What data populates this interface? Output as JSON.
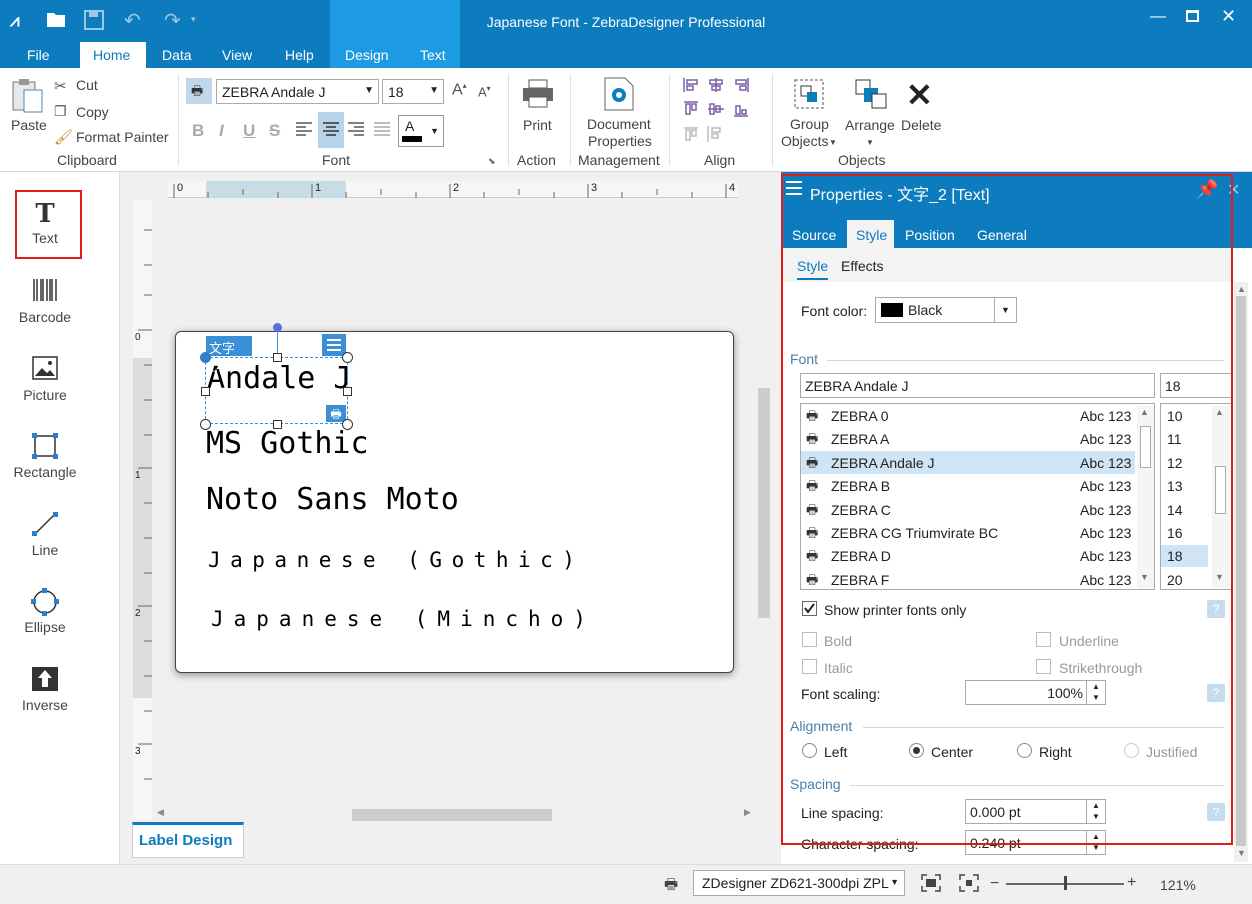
{
  "window": {
    "title": "Japanese Font - ZebraDesigner Professional"
  },
  "menu_tabs": [
    "File",
    "Home",
    "Data",
    "View",
    "Help",
    "Design",
    "Text"
  ],
  "ribbon": {
    "clipboard": {
      "paste": "Paste",
      "cut": "Cut",
      "copy": "Copy",
      "format_painter": "Format Painter",
      "group": "Clipboard"
    },
    "font": {
      "family": "ZEBRA Andale J",
      "size": "18",
      "group": "Font",
      "color_letter": "A"
    },
    "action": {
      "print": "Print",
      "group": "Action"
    },
    "management": {
      "line1": "Document",
      "line2": "Properties",
      "group": "Management"
    },
    "align": {
      "group": "Align"
    },
    "objects": {
      "group_line1": "Group",
      "group_line2": "Objects",
      "arrange": "Arrange",
      "delete": "Delete",
      "group": "Objects"
    }
  },
  "toolbox": [
    "Text",
    "Barcode",
    "Picture",
    "Rectangle",
    "Line",
    "Ellipse",
    "Inverse"
  ],
  "rulers": {
    "h": [
      "0",
      "1",
      "2",
      "3",
      "4"
    ],
    "v": [
      "0",
      "1",
      "2",
      "3"
    ]
  },
  "label": {
    "selected_name": "文字_2",
    "lines": [
      "Andale J",
      "MS Gothic",
      "Noto Sans Moto",
      "Japanese (Gothic)",
      "Japanese (Mincho)"
    ]
  },
  "bottom_tab": "Label Design",
  "properties": {
    "title": "Properties - 文字_2 [Text]",
    "tabs": [
      "Source",
      "Style",
      "Position",
      "General"
    ],
    "subtabs": [
      "Style",
      "Effects"
    ],
    "font_color_label": "Font color:",
    "font_color_value": "Black",
    "font_section": "Font",
    "font_name": "ZEBRA Andale J",
    "font_size": "18",
    "font_list": [
      {
        "name": "ZEBRA 0",
        "sample": "Abc 123"
      },
      {
        "name": "ZEBRA A",
        "sample": "Abc 123"
      },
      {
        "name": "ZEBRA Andale J",
        "sample": "Abc 123"
      },
      {
        "name": "ZEBRA B",
        "sample": "Abc 123"
      },
      {
        "name": "ZEBRA C",
        "sample": "Abc 123"
      },
      {
        "name": "ZEBRA CG Triumvirate BC",
        "sample": "Abc 123"
      },
      {
        "name": "ZEBRA D",
        "sample": "Abc 123"
      },
      {
        "name": "ZEBRA F",
        "sample": "Abc 123"
      }
    ],
    "size_list": [
      "10",
      "11",
      "12",
      "13",
      "14",
      "16",
      "18",
      "20"
    ],
    "show_printer_fonts": "Show printer fonts only",
    "bold": "Bold",
    "italic": "Italic",
    "underline": "Underline",
    "strikethrough": "Strikethrough",
    "font_scaling_label": "Font scaling:",
    "font_scaling_value": "100%",
    "alignment_section": "Alignment",
    "align_left": "Left",
    "align_center": "Center",
    "align_right": "Right",
    "align_justified": "Justified",
    "spacing_section": "Spacing",
    "line_spacing_label": "Line spacing:",
    "line_spacing_value": "0.000 pt",
    "char_spacing_label": "Character spacing:",
    "char_spacing_value": "0.240 pt"
  },
  "status": {
    "printer": "ZDesigner ZD621-300dpi ZPL",
    "zoom": "121%"
  },
  "colors": {
    "titlebar": "#0d7cbe",
    "context_tab": "#1d9be2",
    "selected_row": "#cfe5f6",
    "highlight": "#e21a1a"
  }
}
